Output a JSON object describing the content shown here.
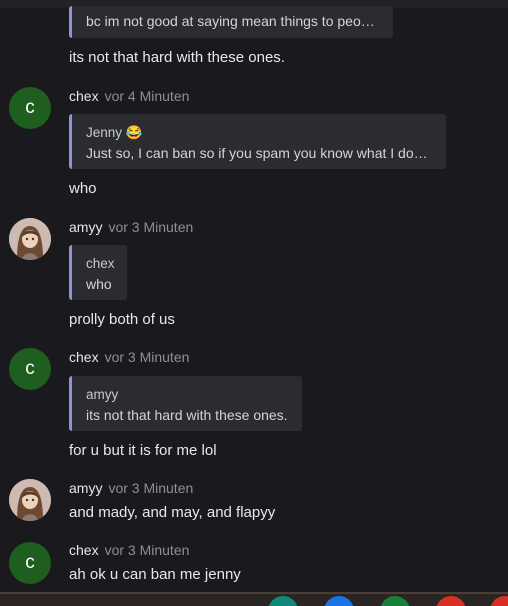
{
  "messages": [
    {
      "quote_text": "bc im not good at saying mean things to people",
      "text": "its not that hard with these ones."
    },
    {
      "author": "chex",
      "avatar_letter": "c",
      "time": "vor 4 Minuten",
      "quote_author": "Jenny 😂",
      "quote_text": "Just so, I can ban so if you spam you know what I do…",
      "text": "who"
    },
    {
      "author": "amyy",
      "time": "vor 3 Minuten",
      "quote_author": "chex",
      "quote_text": "who",
      "text": "prolly both of us"
    },
    {
      "author": "chex",
      "avatar_letter": "c",
      "time": "vor 3 Minuten",
      "quote_author": "amyy",
      "quote_text": "its not that hard with these ones.",
      "text": "for u but it is for me lol"
    },
    {
      "author": "amyy",
      "time": "vor 3 Minuten",
      "text": "and mady, and may, and flapyy"
    },
    {
      "author": "chex",
      "avatar_letter": "c",
      "time": "vor 3 Minuten",
      "text": "ah ok u can ban me jenny"
    }
  ],
  "taskbar": {
    "icons": [
      {
        "name": "meet-icon",
        "color": "#0f8a7a"
      },
      {
        "name": "docs-icon",
        "color": "#1a73e8"
      },
      {
        "name": "sheets-icon",
        "color": "#188038"
      },
      {
        "name": "chrome-icon",
        "color": "#d93025"
      },
      {
        "name": "app-icon",
        "color": "#d93025"
      }
    ]
  }
}
